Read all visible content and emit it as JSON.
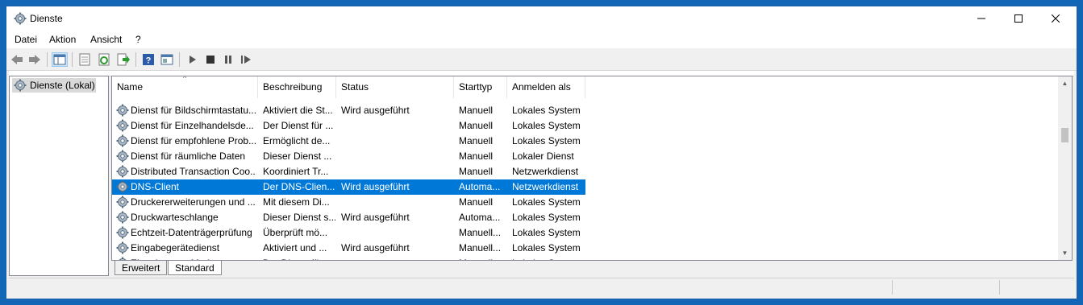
{
  "window": {
    "title": "Dienste"
  },
  "menu": [
    "Datei",
    "Aktion",
    "Ansicht",
    "?"
  ],
  "toolbar": {
    "icons": [
      "back-icon",
      "forward-icon",
      "console-tree-icon",
      "properties-icon",
      "refresh-icon",
      "export-icon",
      "help-icon",
      "view-icon",
      "start-icon",
      "stop-icon",
      "pause-icon",
      "restart-icon"
    ]
  },
  "tree": {
    "root": "Dienste (Lokal)"
  },
  "columns": [
    "Name",
    "Beschreibung",
    "Status",
    "Starttyp",
    "Anmelden als"
  ],
  "rows": [
    {
      "name": "Dienst für Bildschirmtastatu...",
      "desc": "Aktiviert die St...",
      "status": "Wird ausgeführt",
      "start": "Manuell",
      "logon": "Lokales System"
    },
    {
      "name": "Dienst für Einzelhandelsde...",
      "desc": "Der Dienst für ...",
      "status": "",
      "start": "Manuell",
      "logon": "Lokales System"
    },
    {
      "name": "Dienst für empfohlene Prob...",
      "desc": "Ermöglicht de...",
      "status": "",
      "start": "Manuell",
      "logon": "Lokales System"
    },
    {
      "name": "Dienst für räumliche Daten",
      "desc": "Dieser Dienst ...",
      "status": "",
      "start": "Manuell",
      "logon": "Lokaler Dienst"
    },
    {
      "name": "Distributed Transaction Coo...",
      "desc": "Koordiniert Tr...",
      "status": "",
      "start": "Manuell",
      "logon": "Netzwerkdienst"
    },
    {
      "name": "DNS-Client",
      "desc": "Der DNS-Clien...",
      "status": "Wird ausgeführt",
      "start": "Automa...",
      "logon": "Netzwerkdienst",
      "selected": true
    },
    {
      "name": "Druckererweiterungen und ...",
      "desc": "Mit diesem Di...",
      "status": "",
      "start": "Manuell",
      "logon": "Lokales System"
    },
    {
      "name": "Druckwarteschlange",
      "desc": "Dieser Dienst s...",
      "status": "Wird ausgeführt",
      "start": "Automa...",
      "logon": "Lokales System"
    },
    {
      "name": "Echtzeit-Datenträgerprüfung",
      "desc": "Überprüft mö...",
      "status": "",
      "start": "Manuell...",
      "logon": "Lokales System"
    },
    {
      "name": "Eingabegerätedienst",
      "desc": "Aktiviert und ...",
      "status": "Wird ausgeführt",
      "start": "Manuell...",
      "logon": "Lokales System"
    },
    {
      "name": "Eingebetteter Modus",
      "desc": "Der Dienst für...",
      "status": "",
      "start": "Manuell",
      "logon": "Lokales System"
    }
  ],
  "tabs": [
    "Erweitert",
    "Standard"
  ]
}
